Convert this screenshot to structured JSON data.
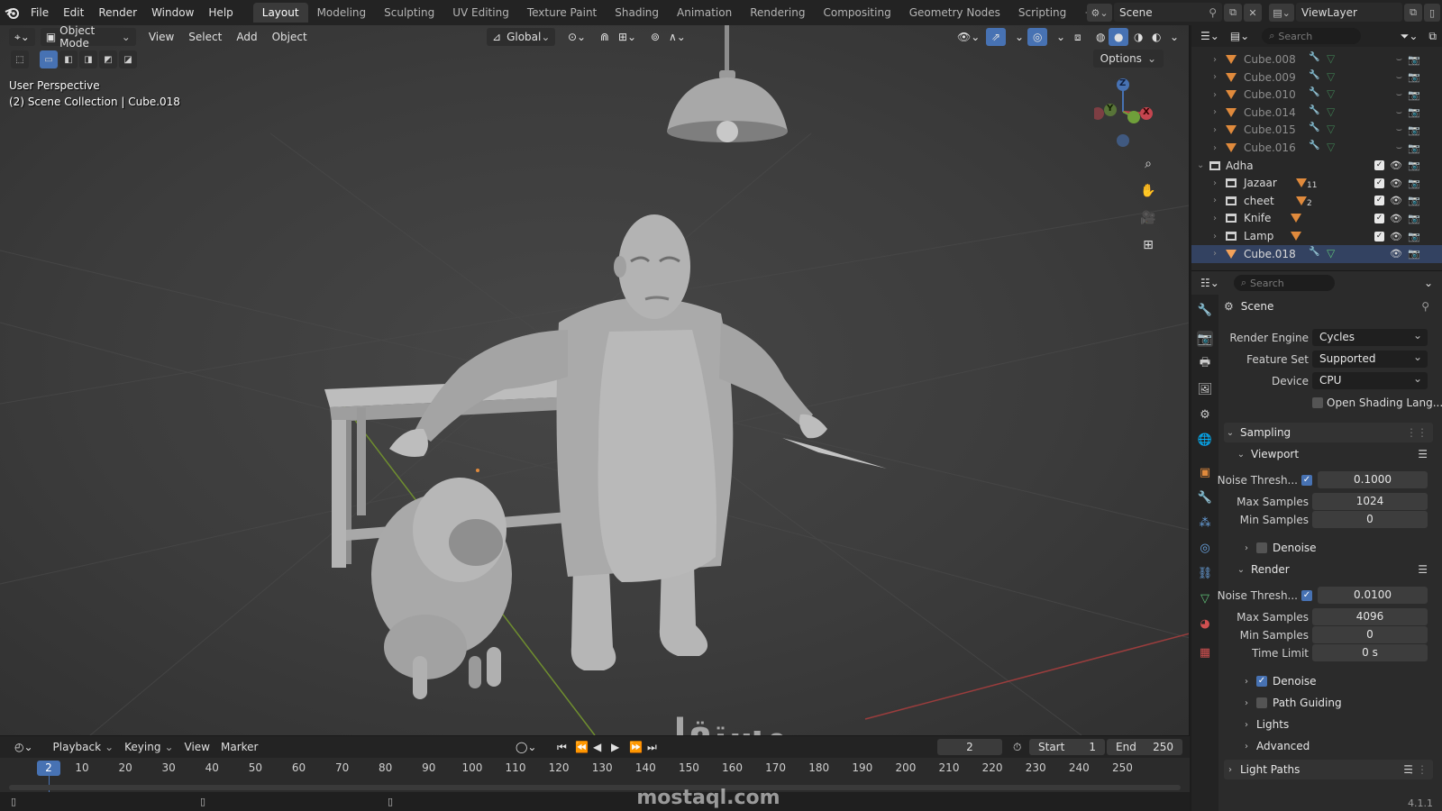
{
  "menu": {
    "items": [
      "File",
      "Edit",
      "Render",
      "Window",
      "Help"
    ]
  },
  "workspaces": {
    "tabs": [
      "Layout",
      "Modeling",
      "Sculpting",
      "UV Editing",
      "Texture Paint",
      "Shading",
      "Animation",
      "Rendering",
      "Compositing",
      "Geometry Nodes",
      "Scripting"
    ],
    "active": "Layout",
    "add": "+"
  },
  "scene": {
    "name": "Scene",
    "view_layer": "ViewLayer"
  },
  "viewport": {
    "mode": "Object Mode",
    "menu": [
      "View",
      "Select",
      "Add",
      "Object"
    ],
    "orientation": "Global",
    "options": "Options",
    "perspective": "User Perspective",
    "collection_info": "(2) Scene Collection | Cube.018",
    "gizmo": {
      "z": "Z",
      "y": "Y",
      "x": "X"
    }
  },
  "timeline": {
    "menu": [
      "Playback",
      "Keying",
      "View",
      "Marker"
    ],
    "current_frame": "2",
    "start_label": "Start",
    "start": "1",
    "end_label": "End",
    "end": "250",
    "ticks": [
      "10",
      "20",
      "30",
      "40",
      "50",
      "60",
      "70",
      "80",
      "90",
      "100",
      "110",
      "120",
      "130",
      "140",
      "150",
      "160",
      "170",
      "180",
      "190",
      "200",
      "210",
      "220",
      "230",
      "240",
      "250"
    ]
  },
  "outliner": {
    "search_placeholder": "Search",
    "rows": [
      {
        "name": "Cube.008",
        "faded": true
      },
      {
        "name": "Cube.009",
        "faded": true
      },
      {
        "name": "Cube.010",
        "faded": true
      },
      {
        "name": "Cube.014",
        "faded": true
      },
      {
        "name": "Cube.015",
        "faded": true
      },
      {
        "name": "Cube.016",
        "faded": true
      },
      {
        "name": "Adha",
        "collection": true
      },
      {
        "name": "Jazaar",
        "badge": "11"
      },
      {
        "name": "cheet",
        "badge": "2"
      },
      {
        "name": "Knife"
      },
      {
        "name": "Lamp"
      },
      {
        "name": "Cube.018"
      }
    ]
  },
  "properties": {
    "search_placeholder": "Search",
    "context": "Scene",
    "render_engine_label": "Render Engine",
    "render_engine": "Cycles",
    "feature_set_label": "Feature Set",
    "feature_set": "Supported",
    "device_label": "Device",
    "device": "CPU",
    "osl_label": "Open Shading Lang...",
    "sampling": "Sampling",
    "viewport": {
      "title": "Viewport",
      "noise_label": "Noise Thresh...",
      "noise": "0.1000",
      "max_label": "Max Samples",
      "max": "1024",
      "min_label": "Min Samples",
      "min": "0",
      "denoise": "Denoise"
    },
    "render": {
      "title": "Render",
      "noise_label": "Noise Thresh...",
      "noise": "0.0100",
      "max_label": "Max Samples",
      "max": "4096",
      "min_label": "Min Samples",
      "min": "0",
      "time_label": "Time Limit",
      "time": "0 s",
      "denoise": "Denoise"
    },
    "path_guiding": "Path Guiding",
    "lights": "Lights",
    "advanced": "Advanced",
    "light_paths": "Light Paths"
  },
  "watermark": {
    "arabic": "مستقل",
    "latin": "mostaql.com"
  },
  "version": "4.1.1",
  "colors": {
    "accent": "#4772b3",
    "object_orange": "#e08a3c",
    "mesh_green": "#5fbf77"
  }
}
